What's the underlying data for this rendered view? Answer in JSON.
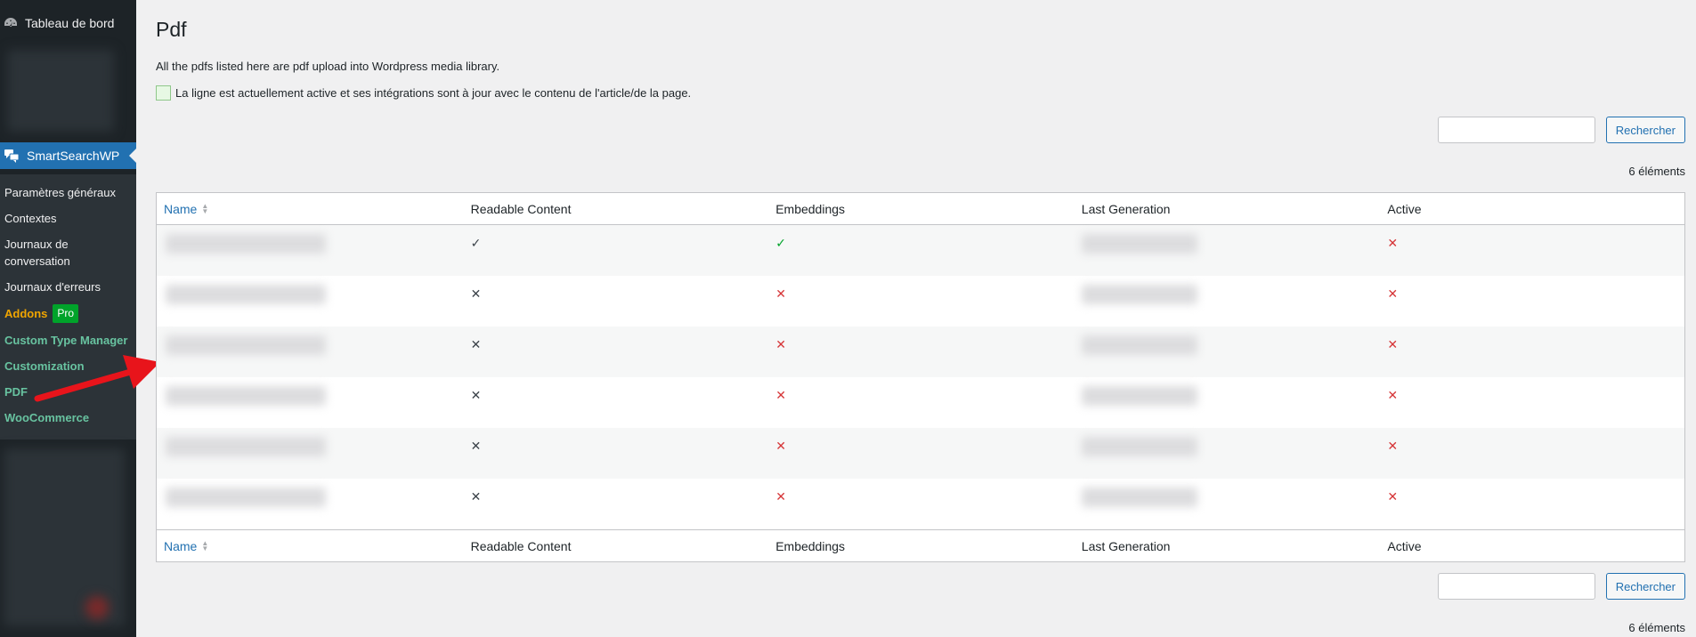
{
  "sidebar": {
    "dashboard_label": "Tableau de bord",
    "current_label": "SmartSearchWP",
    "submenu": [
      {
        "label": "Paramètres généraux",
        "style": "normal"
      },
      {
        "label": "Contextes",
        "style": "normal"
      },
      {
        "label": "Journaux de conversation",
        "style": "normal"
      },
      {
        "label": "Journaux d'erreurs",
        "style": "normal"
      },
      {
        "label": "Addons",
        "style": "orange",
        "badge": "Pro"
      },
      {
        "label": "Custom Type Manager",
        "style": "green"
      },
      {
        "label": "Customization",
        "style": "green"
      },
      {
        "label": "PDF",
        "style": "green"
      },
      {
        "label": "WooCommerce",
        "style": "green"
      }
    ]
  },
  "page": {
    "title": "Pdf",
    "description": "All the pdfs listed here are pdf upload into Wordpress media library.",
    "legend_text": "La ligne est actuellement active et ses intégrations sont à jour avec le contenu de l'article/de la page.",
    "search_button": "Rechercher",
    "count_label": "6 éléments"
  },
  "table": {
    "columns": [
      "Name",
      "Readable Content",
      "Embeddings",
      "Last Generation",
      "Active"
    ],
    "rows": [
      {
        "readable": "check",
        "embeddings": "check-green",
        "active": "x-red"
      },
      {
        "readable": "x",
        "embeddings": "x-red",
        "active": "x-red"
      },
      {
        "readable": "x",
        "embeddings": "x-red",
        "active": "x-red"
      },
      {
        "readable": "x",
        "embeddings": "x-red",
        "active": "x-red"
      },
      {
        "readable": "x",
        "embeddings": "x-red",
        "active": "x-red"
      },
      {
        "readable": "x",
        "embeddings": "x-red",
        "active": "x-red"
      }
    ]
  },
  "colors": {
    "admin_bar": "#1d2327",
    "accent": "#2271b1",
    "success": "#00a32a",
    "error": "#d63638",
    "addons": "#f0a500",
    "plugin_links": "#68c3a0"
  },
  "icons": {
    "dashboard": "gauge-icon",
    "plugin": "chat-bubbles-icon",
    "sort": "sort-arrows-icon",
    "check": "check-icon",
    "cross": "cross-icon"
  }
}
